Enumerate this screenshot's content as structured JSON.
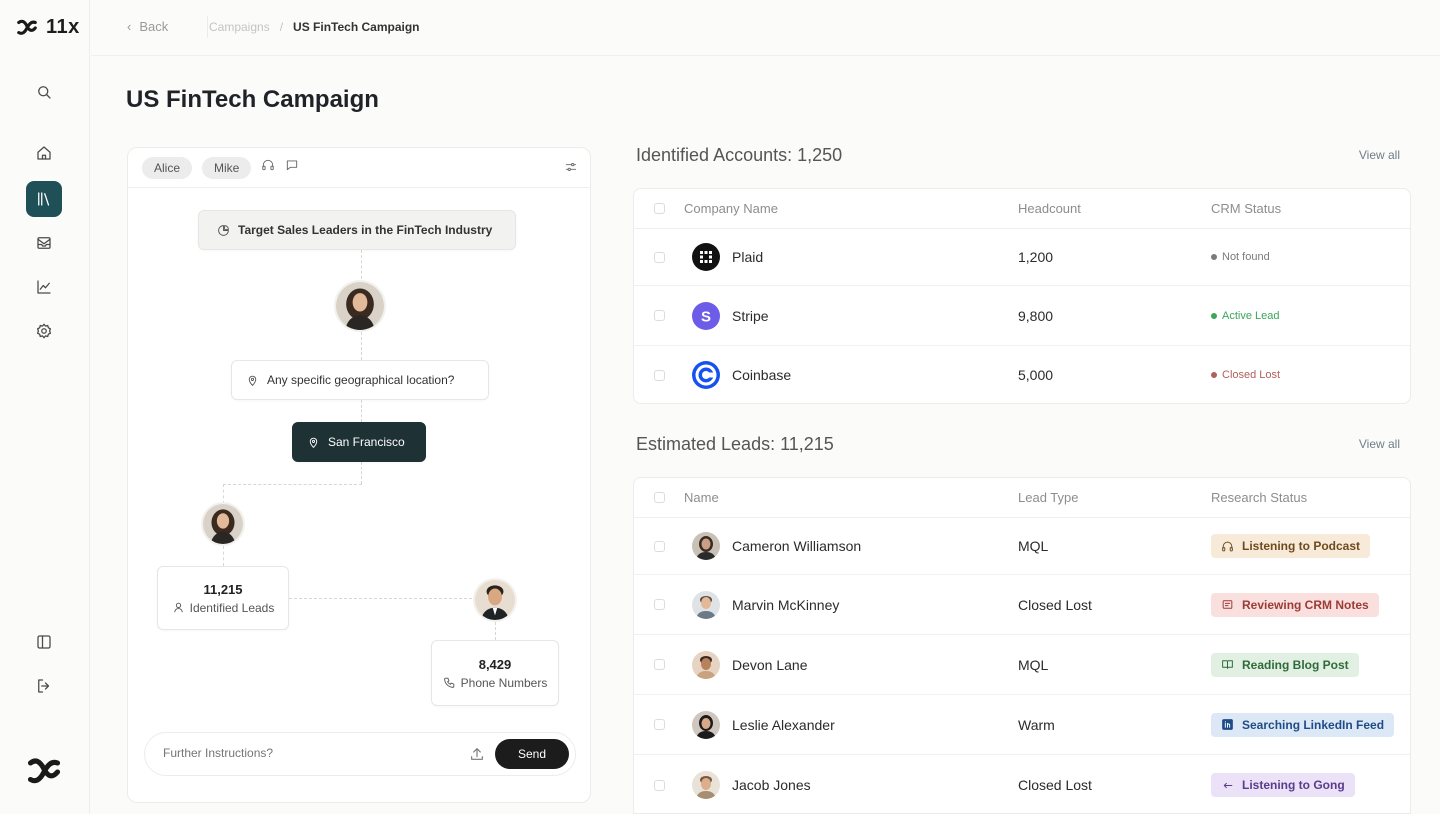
{
  "app": {
    "logo_text": "11x"
  },
  "topbar": {
    "back_label": "Back",
    "breadcrumb_parent": "Campaigns",
    "breadcrumb_separator": "/",
    "breadcrumb_current": "US FinTech Campaign"
  },
  "page": {
    "title": "US FinTech Campaign"
  },
  "sidebar": {
    "items": [
      {
        "name": "search",
        "icon": "search-icon",
        "active": false
      },
      {
        "name": "home",
        "icon": "home-icon",
        "active": false
      },
      {
        "name": "library",
        "icon": "library-icon",
        "active": true
      },
      {
        "name": "inbox",
        "icon": "mail-icon",
        "active": false
      },
      {
        "name": "analytics",
        "icon": "chart-icon",
        "active": false
      },
      {
        "name": "settings",
        "icon": "gear-icon",
        "active": false
      },
      {
        "name": "panel",
        "icon": "sidebar-toggle-icon",
        "active": false
      },
      {
        "name": "logout",
        "icon": "logout-icon",
        "active": false
      }
    ]
  },
  "flow": {
    "chips": [
      "Alice",
      "Mike"
    ],
    "target": "Target Sales Leaders in the FinTech Industry",
    "question": "Any specific geographical location?",
    "answer": "San Francisco",
    "leads_count": "11,215",
    "leads_label": "Identified Leads",
    "phone_count": "8,429",
    "phone_label": "Phone Numbers",
    "instruction_placeholder": "Further Instructions?",
    "send_label": "Send"
  },
  "accounts": {
    "title": "Identified Accounts: 1,250",
    "view_all": "View all",
    "columns": [
      "Company Name",
      "Headcount",
      "CRM Status"
    ],
    "rows": [
      {
        "company": "Plaid",
        "headcount": "1,200",
        "status": "Not found",
        "status_color": "#7a7a7a",
        "logo": "plaid-logo-icon"
      },
      {
        "company": "Stripe",
        "headcount": "9,800",
        "status": "Active Lead",
        "status_color": "#3aa65a",
        "logo": "stripe-logo-icon"
      },
      {
        "company": "Coinbase",
        "headcount": "5,000",
        "status": "Closed Lost",
        "status_color": "#b0605c",
        "logo": "coinbase-logo-icon"
      }
    ]
  },
  "leads": {
    "title": "Estimated Leads: 11,215",
    "view_all": "View all",
    "columns": [
      "Name",
      "Lead Type",
      "Research Status"
    ],
    "rows": [
      {
        "name": "Cameron Williamson",
        "type": "MQL",
        "status": "Listening to Podcast",
        "icon": "headphones-icon",
        "bg": "#f7ead9",
        "fg": "#6e4a1f"
      },
      {
        "name": "Marvin McKinney",
        "type": "Closed Lost",
        "status": "Reviewing CRM Notes",
        "icon": "notes-icon",
        "bg": "#f9e0de",
        "fg": "#9c3b35"
      },
      {
        "name": "Devon Lane",
        "type": "MQL",
        "status": "Reading Blog Post",
        "icon": "book-icon",
        "bg": "#e2f0e3",
        "fg": "#2f6b3a"
      },
      {
        "name": "Leslie Alexander",
        "type": "Warm",
        "status": "Searching LinkedIn Feed",
        "icon": "linkedin-icon",
        "bg": "#dde8f6",
        "fg": "#1f4c86"
      },
      {
        "name": "Jacob Jones",
        "type": "Closed Lost",
        "status": "Listening to Gong",
        "icon": "gong-icon",
        "bg": "#ebe2f7",
        "fg": "#5a3b8c"
      }
    ]
  }
}
